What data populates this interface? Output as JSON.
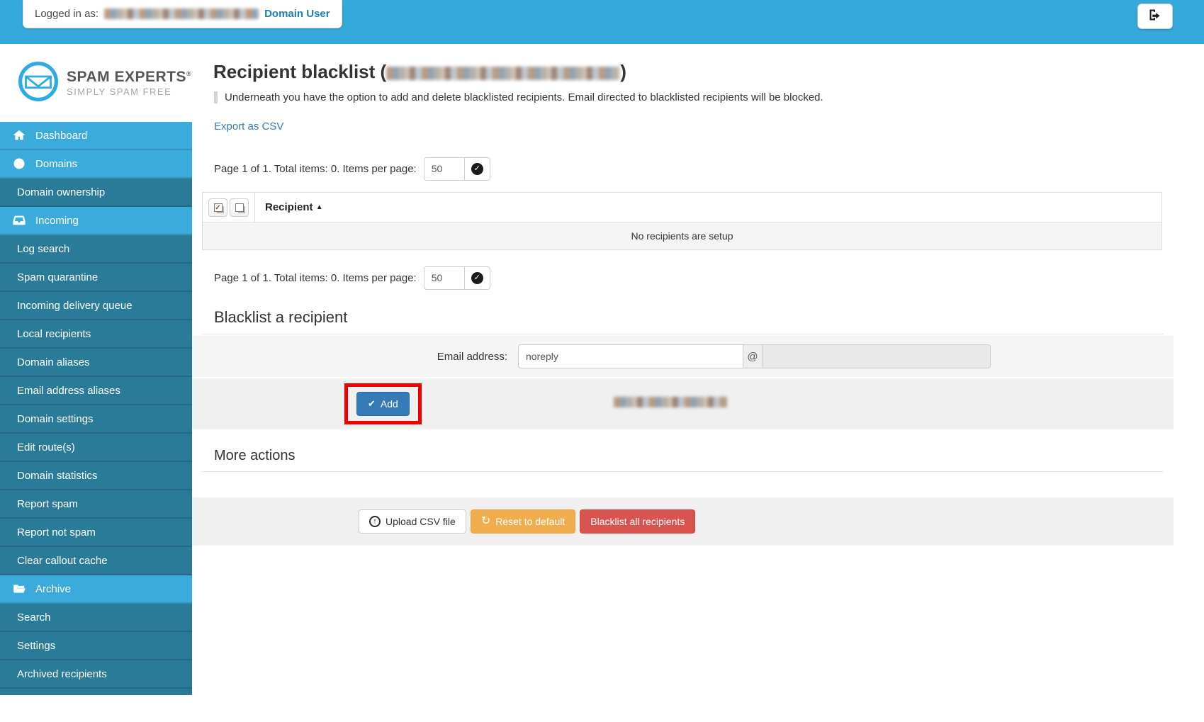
{
  "topbar": {
    "logged_in_prefix": "Logged in as:",
    "role": "Domain User"
  },
  "logo": {
    "brand": "SPAM EXPERTS",
    "registered": "®",
    "tagline": "SIMPLY SPAM FREE"
  },
  "sidebar": {
    "items": [
      {
        "label": "Dashboard",
        "kind": "parent",
        "icon": "home"
      },
      {
        "label": "Domains",
        "kind": "parent",
        "icon": "globe"
      },
      {
        "label": "Domain ownership",
        "kind": "sub"
      },
      {
        "label": "Incoming",
        "kind": "parent",
        "icon": "inbox"
      },
      {
        "label": "Log search",
        "kind": "sub"
      },
      {
        "label": "Spam quarantine",
        "kind": "sub"
      },
      {
        "label": "Incoming delivery queue",
        "kind": "sub"
      },
      {
        "label": "Local recipients",
        "kind": "sub"
      },
      {
        "label": "Domain aliases",
        "kind": "sub"
      },
      {
        "label": "Email address aliases",
        "kind": "sub"
      },
      {
        "label": "Domain settings",
        "kind": "sub"
      },
      {
        "label": "Edit route(s)",
        "kind": "sub"
      },
      {
        "label": "Domain statistics",
        "kind": "sub"
      },
      {
        "label": "Report spam",
        "kind": "sub"
      },
      {
        "label": "Report not spam",
        "kind": "sub"
      },
      {
        "label": "Clear callout cache",
        "kind": "sub"
      },
      {
        "label": "Archive",
        "kind": "parent",
        "icon": "folder-open"
      },
      {
        "label": "Search",
        "kind": "sub"
      },
      {
        "label": "Settings",
        "kind": "sub"
      },
      {
        "label": "Archived recipients",
        "kind": "sub"
      }
    ]
  },
  "main": {
    "title_prefix": "Recipient blacklist (",
    "title_suffix": ")",
    "description": "Underneath you have the option to add and delete blacklisted recipients. Email directed to blacklisted recipients will be blocked.",
    "export_link": "Export as CSV",
    "pagination": {
      "text": "Page 1 of 1. Total items: 0. Items per page:",
      "per_page_value": "50"
    },
    "table": {
      "header": "Recipient",
      "sort_arrow": "▲",
      "empty_text": "No recipients are setup"
    },
    "form": {
      "heading": "Blacklist a recipient",
      "email_label": "Email address:",
      "email_value": "noreply",
      "at_sign": "@",
      "add_label": "Add",
      "add_check": "✔"
    },
    "more_actions": {
      "heading": "More actions",
      "upload_label": "Upload CSV file",
      "upload_glyph": "↑",
      "reset_label": "Reset to default",
      "reset_glyph": "↻",
      "blacklist_all_label": "Blacklist all recipients"
    }
  },
  "colors": {
    "topbar": "#36a9dc",
    "sidebar_parent": "#3aabdb",
    "sidebar_sub": "#2a7b97",
    "link_blue": "#337ab7",
    "primary_button": "#337ab7",
    "warning_button": "#f0ad4e",
    "danger_button": "#d9534f",
    "highlight_red": "#ee0000",
    "empty_row_bg": "#f5f5f5"
  }
}
